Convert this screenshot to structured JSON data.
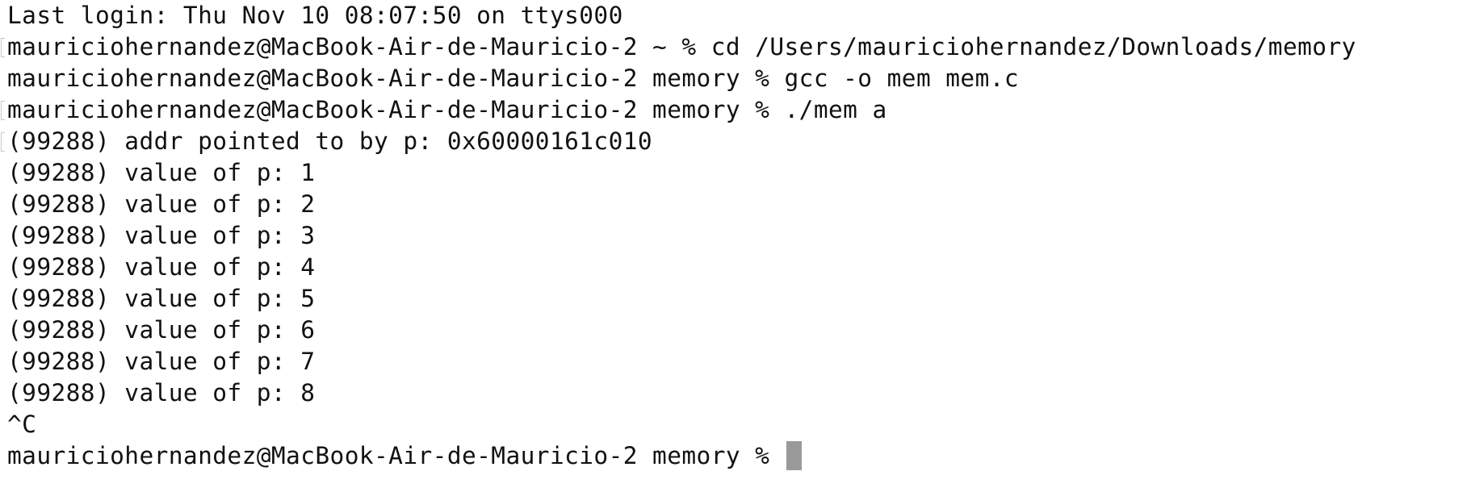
{
  "terminal": {
    "lines": [
      {
        "text": "Last login: Thu Nov 10 08:07:50 on ttys000",
        "marked": false
      },
      {
        "text": "mauriciohernandez@MacBook-Air-de-Mauricio-2 ~ % cd /Users/mauriciohernandez/Downloads/memory",
        "marked": true
      },
      {
        "text": "mauriciohernandez@MacBook-Air-de-Mauricio-2 memory % gcc -o mem mem.c",
        "marked": false
      },
      {
        "text": "mauriciohernandez@MacBook-Air-de-Mauricio-2 memory % ./mem a",
        "marked": true
      },
      {
        "text": "(99288) addr pointed to by p: 0x60000161c010",
        "marked": true
      },
      {
        "text": "(99288) value of p: 1",
        "marked": false
      },
      {
        "text": "(99288) value of p: 2",
        "marked": false
      },
      {
        "text": "(99288) value of p: 3",
        "marked": false
      },
      {
        "text": "(99288) value of p: 4",
        "marked": false
      },
      {
        "text": "(99288) value of p: 5",
        "marked": false
      },
      {
        "text": "(99288) value of p: 6",
        "marked": false
      },
      {
        "text": "(99288) value of p: 7",
        "marked": false
      },
      {
        "text": "(99288) value of p: 8",
        "marked": false
      },
      {
        "text": "^C",
        "marked": false
      }
    ],
    "prompt": "mauriciohernandez@MacBook-Air-de-Mauricio-2 memory % ",
    "cursor_color": "#9a9a9a"
  }
}
